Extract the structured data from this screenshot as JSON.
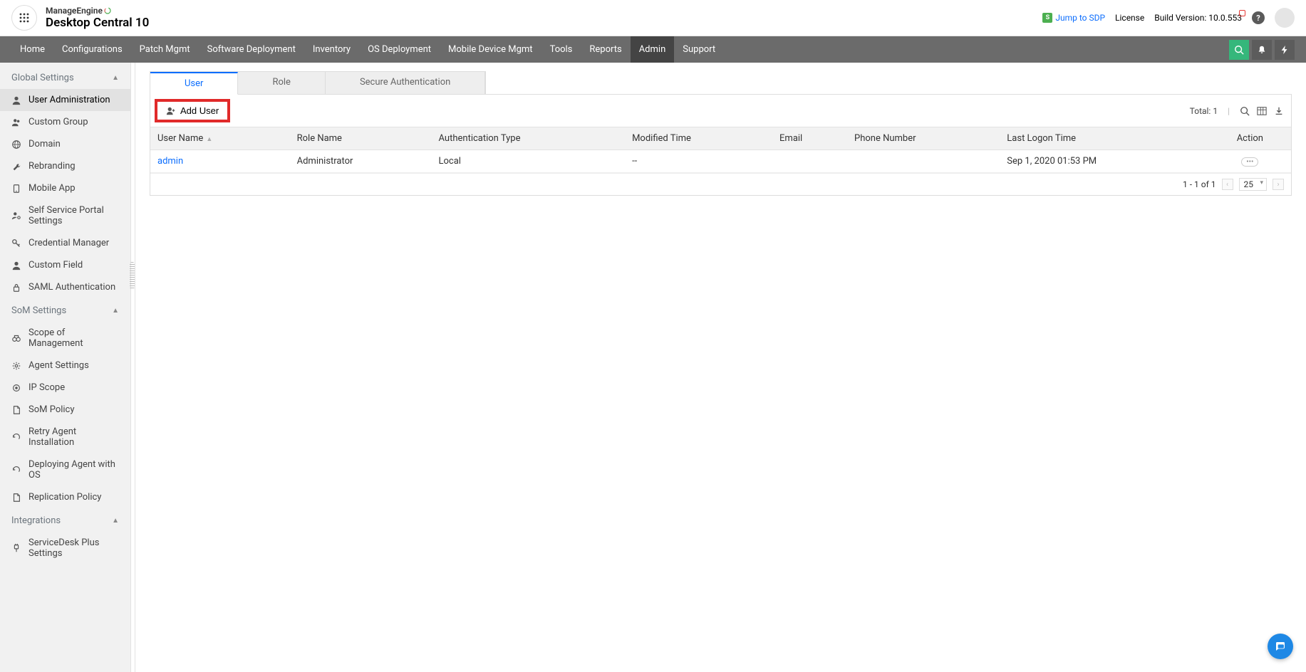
{
  "brand": {
    "top": "ManageEngine",
    "bottom": "Desktop Central 10"
  },
  "header_right": {
    "jump_label": "Jump to SDP",
    "license": "License",
    "build_version": "Build Version: 10.0.553"
  },
  "topnav": {
    "items": [
      "Home",
      "Configurations",
      "Patch Mgmt",
      "Software Deployment",
      "Inventory",
      "OS Deployment",
      "Mobile Device Mgmt",
      "Tools",
      "Reports",
      "Admin",
      "Support"
    ],
    "active_index": 9
  },
  "sidebar": {
    "sections": [
      {
        "title": "Global Settings",
        "items": [
          "User Administration",
          "Custom Group",
          "Domain",
          "Rebranding",
          "Mobile App",
          "Self Service Portal Settings",
          "Credential Manager",
          "Custom Field",
          "SAML Authentication"
        ],
        "icons": [
          "user",
          "users",
          "globe",
          "wrench",
          "mobile",
          "user-gear",
          "key",
          "user",
          "lock"
        ],
        "active_index": 0
      },
      {
        "title": "SoM Settings",
        "items": [
          "Scope of Management",
          "Agent Settings",
          "IP Scope",
          "SoM Policy",
          "Retry Agent Installation",
          "Deploying Agent with OS",
          "Replication Policy"
        ],
        "icons": [
          "binoculars",
          "gear",
          "target",
          "doc",
          "retry",
          "retry",
          "doc"
        ],
        "active_index": -1
      },
      {
        "title": "Integrations",
        "items": [
          "ServiceDesk Plus Settings"
        ],
        "icons": [
          "plug"
        ],
        "active_index": -1
      }
    ]
  },
  "tabs": {
    "items": [
      "User",
      "Role",
      "Secure Authentication"
    ],
    "active_index": 0
  },
  "toolbar": {
    "add_user_label": "Add User",
    "total_label": "Total: 1"
  },
  "table": {
    "columns": [
      "User Name",
      "Role Name",
      "Authentication Type",
      "Modified Time",
      "Email",
      "Phone Number",
      "Last Logon Time",
      "Action"
    ],
    "rows": [
      {
        "user_name": "admin",
        "role_name": "Administrator",
        "auth_type": "Local",
        "modified_time": "--",
        "email": "",
        "phone": "",
        "last_logon": "Sep 1, 2020 01:53 PM"
      }
    ]
  },
  "pager": {
    "range": "1 - 1 of 1",
    "page_size": "25"
  }
}
